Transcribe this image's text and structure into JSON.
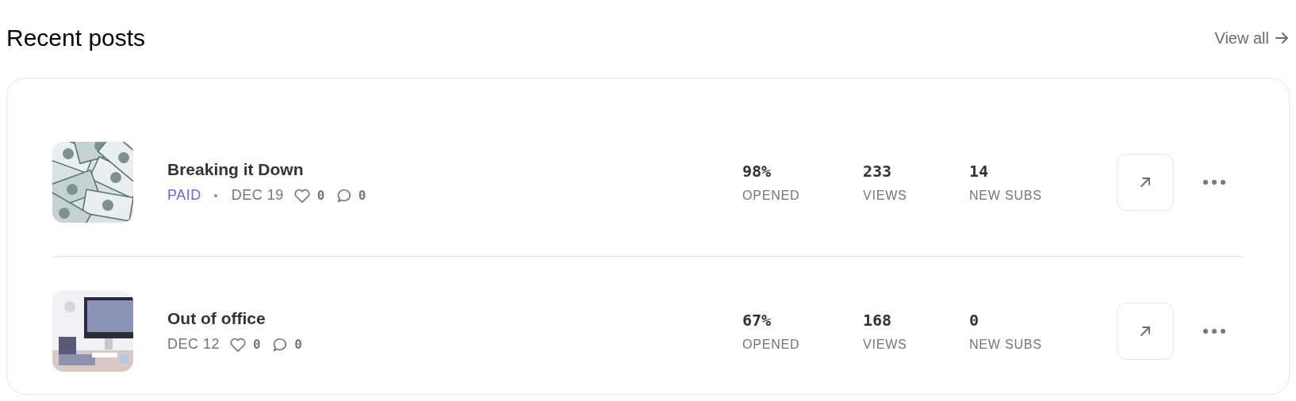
{
  "header": {
    "title": "Recent posts",
    "link": "View all"
  },
  "posts": [
    {
      "title": "Breaking it Down",
      "badge": "PAID",
      "date": "DEC 19",
      "likes": "0",
      "comments": "0",
      "stats": [
        {
          "value": "98%",
          "label": "OPENED"
        },
        {
          "value": "233",
          "label": "VIEWS"
        },
        {
          "value": "14",
          "label": "NEW SUBS"
        }
      ]
    },
    {
      "title": "Out of office",
      "date": "DEC 12",
      "likes": "0",
      "comments": "0",
      "stats": [
        {
          "value": "67%",
          "label": "OPENED"
        },
        {
          "value": "168",
          "label": "VIEWS"
        },
        {
          "value": "0",
          "label": "NEW SUBS"
        }
      ]
    }
  ]
}
